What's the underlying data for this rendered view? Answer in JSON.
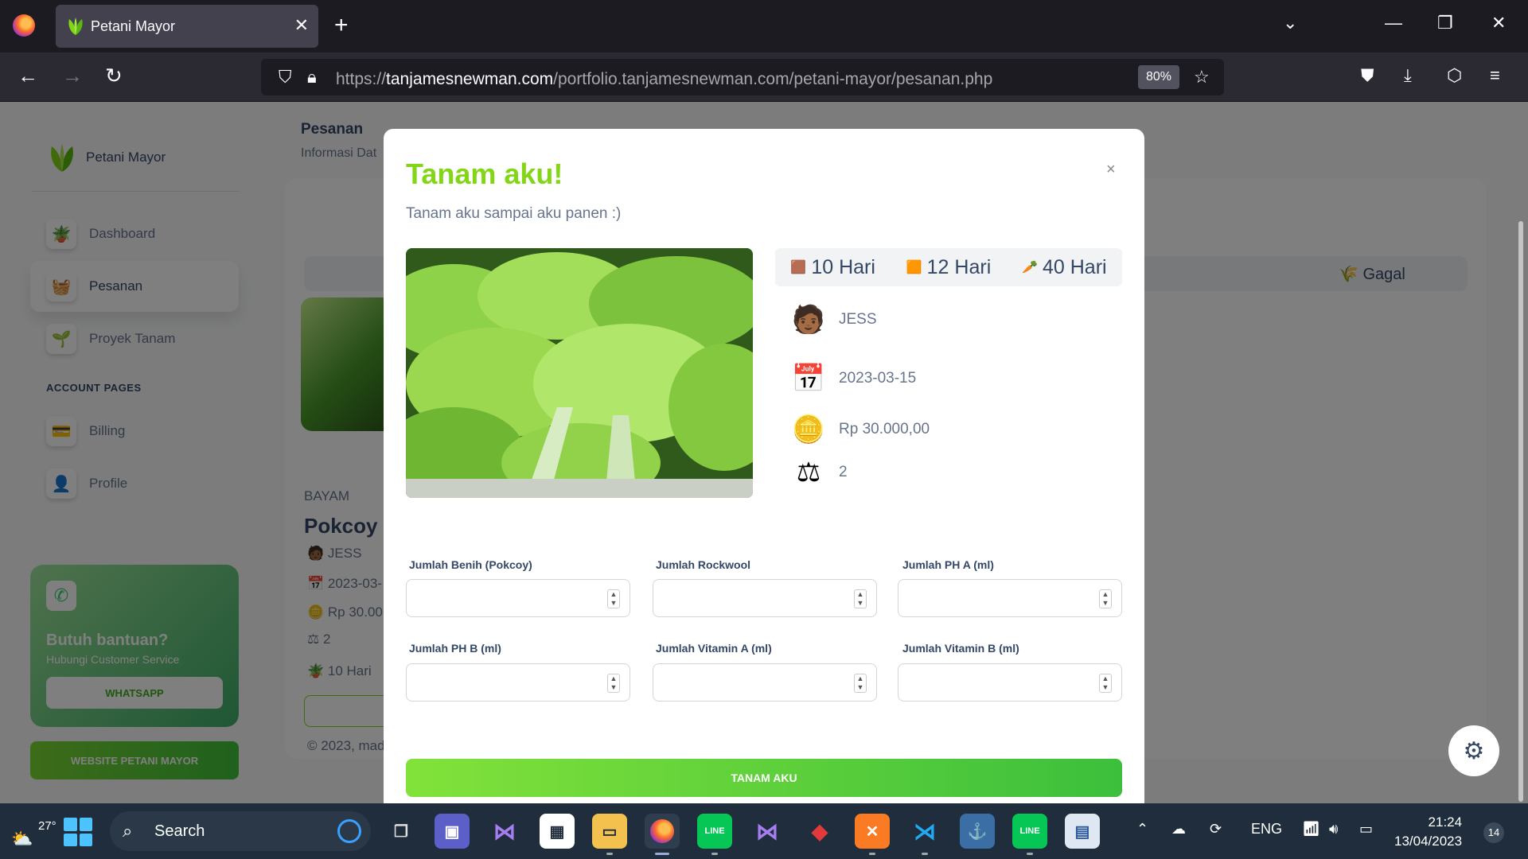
{
  "browser": {
    "tab_title": "Petani Mayor",
    "url_prefix": "https://",
    "url_domain": "tanjamesnewman.com",
    "url_path": "/portfolio.tanjamesnewman.com/petani-mayor/pesanan.php",
    "zoom": "80%"
  },
  "sidebar": {
    "brand": "Petani Mayor",
    "items": [
      {
        "label": "Dashboard"
      },
      {
        "label": "Pesanan"
      },
      {
        "label": "Proyek Tanam"
      }
    ],
    "account_heading": "ACCOUNT PAGES",
    "account_items": [
      {
        "label": "Billing"
      },
      {
        "label": "Profile"
      }
    ],
    "help": {
      "title": "Butuh bantuan?",
      "subtitle": "Hubungi Customer Service",
      "button": "WHATSAPP"
    },
    "website_button": "WEBSITE PETANI MAYOR"
  },
  "page": {
    "title": "Pesanan",
    "subtitle": "Informasi Dat",
    "tab_gagal": "Gagal",
    "card": {
      "category": "BAYAM",
      "name": "Pokcoy",
      "user": "JESS",
      "date": "2023-03-",
      "price": "Rp 30.00",
      "qty": "2",
      "days": "10 Hari"
    },
    "footer": "© 2023, mad"
  },
  "modal": {
    "title": "Tanam aku!",
    "close": "×",
    "subtitle": "Tanam aku sampai aku panen :)",
    "days": [
      "10 Hari",
      "12 Hari",
      "40 Hari"
    ],
    "user": "JESS",
    "date": "2023-03-15",
    "price": "Rp 30.000,00",
    "qty": "2",
    "fields": [
      {
        "label": "Jumlah Benih (Pokcoy)",
        "value": ""
      },
      {
        "label": "Jumlah Rockwool",
        "value": ""
      },
      {
        "label": "Jumlah PH A (ml)",
        "value": ""
      },
      {
        "label": "Jumlah PH B (ml)",
        "value": ""
      },
      {
        "label": "Jumlah Vitamin A (ml)",
        "value": ""
      },
      {
        "label": "Jumlah Vitamin B (ml)",
        "value": ""
      }
    ],
    "submit": "TANAM AKU"
  },
  "taskbar": {
    "temperature": "27°",
    "search": "Search",
    "language": "ENG",
    "time": "21:24",
    "date": "13/04/2023",
    "notifications": "14"
  },
  "colors": {
    "accent": "#82d616",
    "text_dark": "#344767",
    "text_muted": "#67748e"
  }
}
